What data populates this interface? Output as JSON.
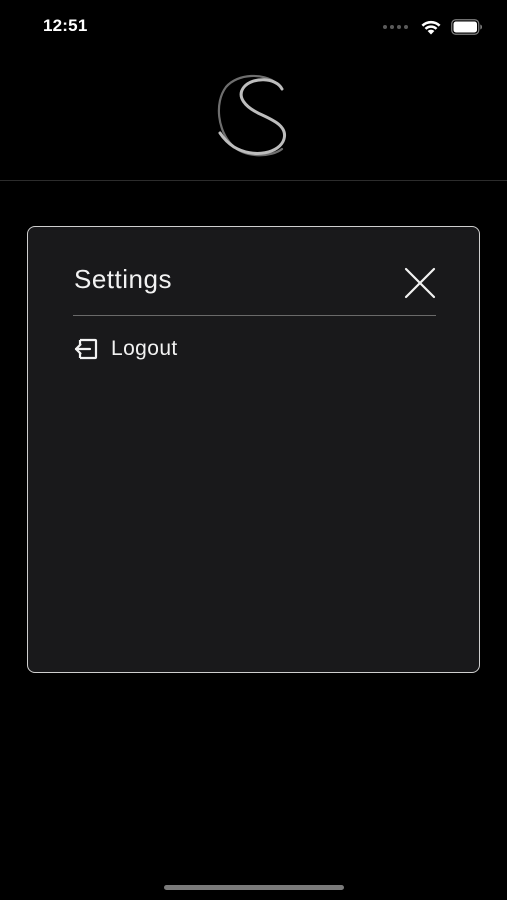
{
  "status_bar": {
    "time": "12:51",
    "icons": [
      "signal-dots-icon",
      "wifi-icon",
      "battery-icon"
    ]
  },
  "header": {
    "logo_icon": "monogram-logo-icon"
  },
  "settings_modal": {
    "title": "Settings",
    "close_icon": "close-icon",
    "items": [
      {
        "label": "Logout",
        "icon": "logout-icon"
      }
    ]
  },
  "colors": {
    "background": "#000000",
    "modal_background": "#19191b",
    "modal_border": "#cfcfcf",
    "text": "#f2f2f2"
  }
}
